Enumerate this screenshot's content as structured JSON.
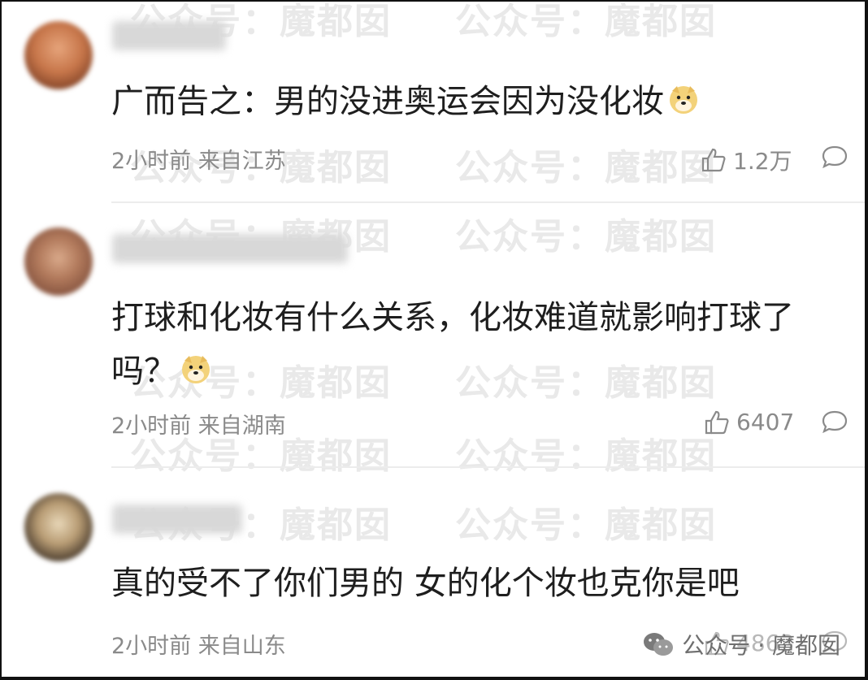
{
  "watermark": "公众号：魔都囡",
  "comments": [
    {
      "text": "广而告之：男的没进奥运会因为没化妆",
      "time": "2小时前",
      "location": "来自江苏",
      "likes": "1.2万",
      "emoji": "doge-emoji"
    },
    {
      "text": "打球和化妆有什么关系，化妆难道就影响打球了吗？",
      "time": "2小时前",
      "location": "来自湖南",
      "likes": "6407",
      "emoji": "doge-emoji"
    },
    {
      "text": "真的受不了你们男的 女的化个妆也克你是吧",
      "time": "2小时前",
      "location": "来自山东",
      "likes": "4863"
    }
  ],
  "brand": {
    "label": "公众号 · 魔都囡",
    "icon": "wechat-icon"
  },
  "colors": {
    "text": "#1e1e1e",
    "meta": "#8a8a8a",
    "watermark": "#e9e9e9",
    "divider": "#ececec"
  }
}
